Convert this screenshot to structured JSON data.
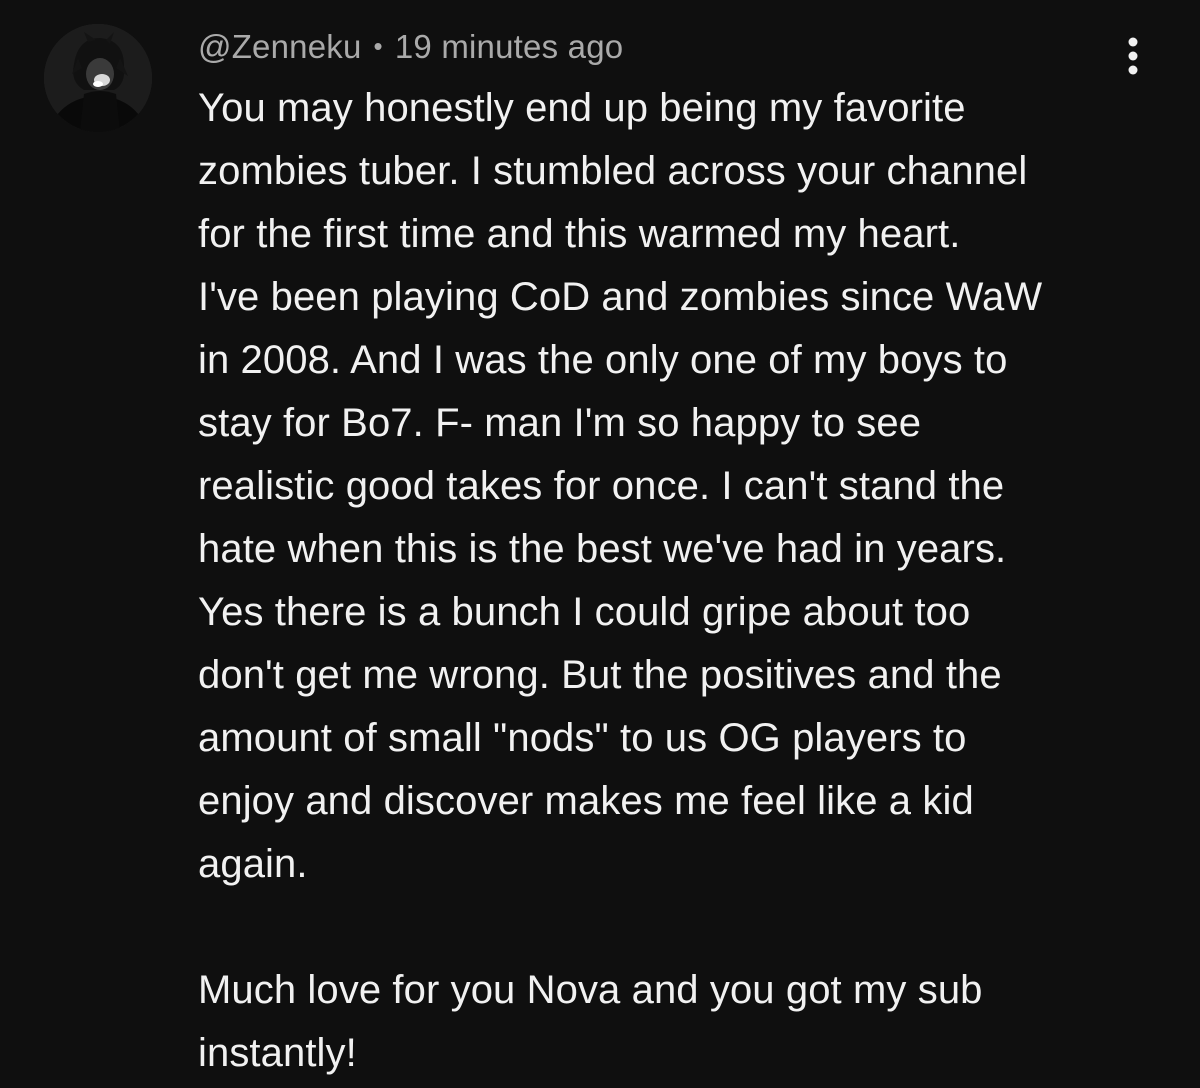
{
  "comment": {
    "author": "@Zenneku",
    "separator": "•",
    "timestamp": "19 minutes ago",
    "avatar_icon": "user-avatar-icon",
    "more_icon": "vertical-dots-icon",
    "lines": [
      "You may honestly end up being my favorite",
      "zombies tuber. I stumbled across your channel",
      "for the first time and this warmed my heart.",
      "I've been playing CoD and zombies since WaW",
      "in 2008. And I was the only one of my boys to",
      "stay for Bo7. F- man I'm so happy to see",
      "realistic good takes for once. I can't stand the",
      "hate when this is the best we've had in years.",
      "Yes there is a bunch I could gripe about too",
      "don't get me wrong. But the positives and the",
      "amount of small \"nods\" to us OG players to",
      "enjoy and discover makes me feel like a kid",
      "again.",
      "",
      "Much love for you Nova and you got my sub",
      "instantly!"
    ]
  },
  "colors": {
    "background": "#0f0f0f",
    "text_primary": "#f1f1f1",
    "text_secondary": "#aaaaaa"
  }
}
